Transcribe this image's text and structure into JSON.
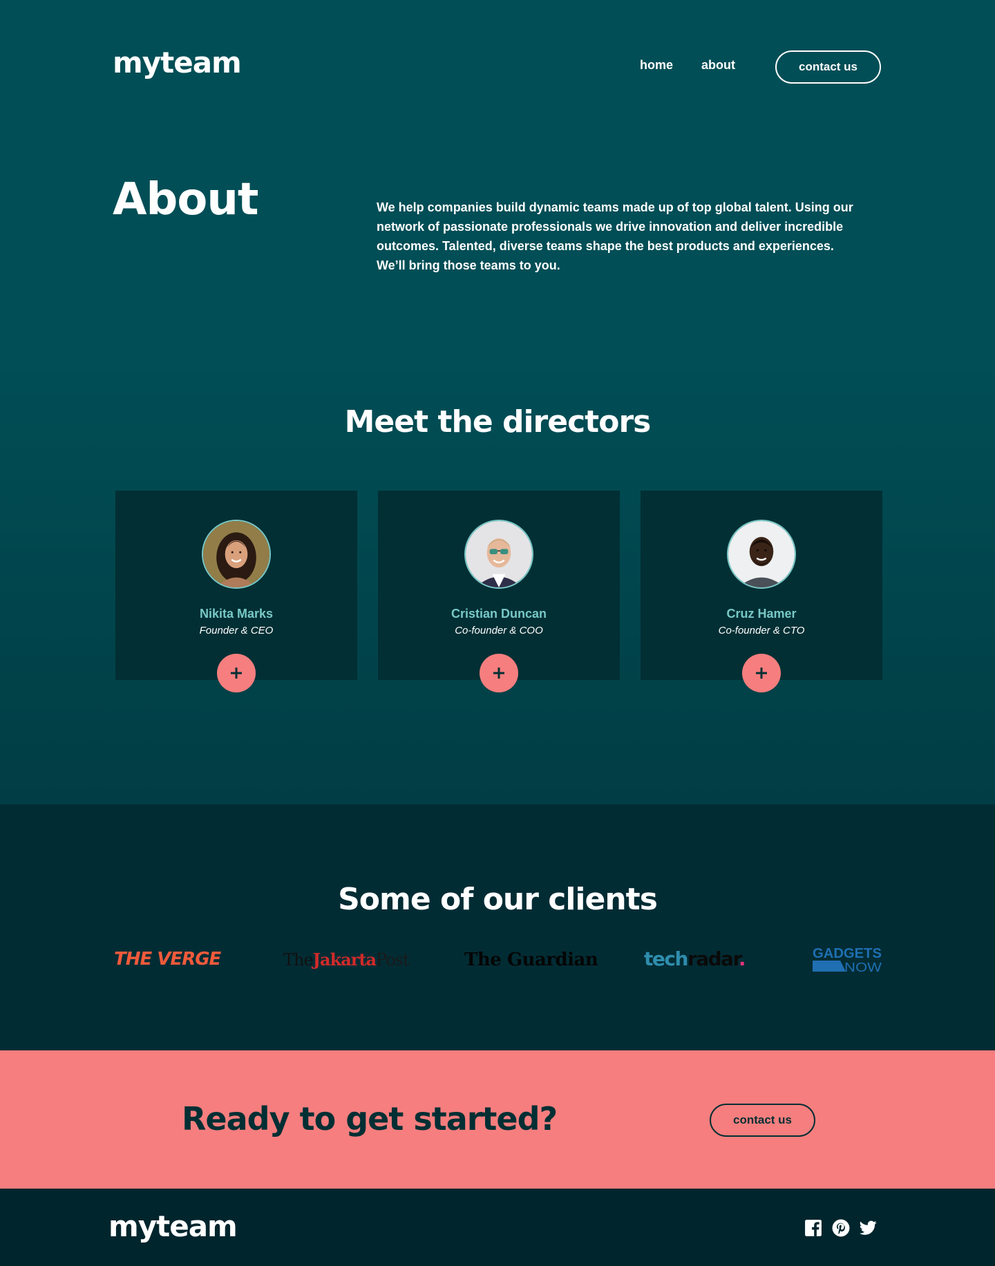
{
  "header": {
    "logo": "myteam",
    "nav": {
      "home": "home",
      "about": "about"
    },
    "contact_button": "contact us"
  },
  "hero": {
    "title": "About",
    "text": "We help companies build dynamic teams made up of top global talent. Using our network of passionate professionals we drive innovation and deliver incredible outcomes. Talented, diverse teams shape the best products and experiences. We’ll bring those teams to you."
  },
  "directors": {
    "title": "Meet the directors",
    "people": [
      {
        "name": "Nikita Marks",
        "role": "Founder & CEO"
      },
      {
        "name": "Cristian Duncan",
        "role": "Co-founder & COO"
      },
      {
        "name": "Cruz Hamer",
        "role": "Co-founder & CTO"
      }
    ]
  },
  "clients": {
    "title": "Some of our clients",
    "logos": {
      "verge": "THE VERGE",
      "jakarta_the": "The",
      "jakarta_main": "Jakarta",
      "jakarta_post": "Post",
      "guardian": "The Guardian",
      "techradar_a": "tech",
      "techradar_b": "radar",
      "techradar_dot": ".",
      "gadgets_top": "GADGETS",
      "gadgets_bottom": "NOW"
    }
  },
  "cta": {
    "title": "Ready to get started?",
    "button": "contact us"
  },
  "footer": {
    "logo": "myteam"
  },
  "colors": {
    "hero_bg": "#014e56",
    "card_bg": "#012f34",
    "accent_teal": "#79c8c7",
    "coral": "#f67e7e",
    "dark": "#00252d"
  }
}
